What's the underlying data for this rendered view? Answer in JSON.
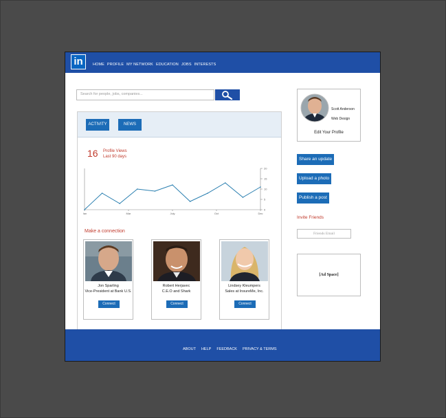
{
  "header": {
    "logo_text": "in",
    "nav": [
      "HOME",
      "PROFILE",
      "MY NETWORK",
      "EDUCATION",
      "JOBS",
      "INTERESTS"
    ]
  },
  "search": {
    "placeholder": "Search for people, jobs, companies..."
  },
  "activity": {
    "tabs": [
      "ACTIVITY",
      "NEWS"
    ],
    "profile_views_count": "16",
    "profile_views_label": "Profile Views",
    "profile_views_period": "Last 90 days"
  },
  "chart_data": {
    "type": "line",
    "x": [
      "Jan",
      "Mar",
      "July",
      "Oct",
      "Dec"
    ],
    "values": [
      0,
      8,
      3,
      10,
      9,
      12,
      4,
      8,
      13,
      6,
      11
    ],
    "y_ticks": [
      "0",
      "5",
      "10",
      "15",
      "20"
    ],
    "ylim": [
      0,
      20
    ],
    "grid": false
  },
  "connections": {
    "heading": "Make a connection",
    "people": [
      {
        "name": "Jon Sparling",
        "title": "Vice-President at Bank U.S.",
        "button": "Connect"
      },
      {
        "name": "Robert Herjavec",
        "title": "C.E.O and Shark",
        "button": "Connect"
      },
      {
        "name": "Lindsey Kleumpers",
        "title": "Sales at InsureMe, Inc.",
        "button": "Connect"
      }
    ]
  },
  "profile": {
    "name": "Scott Anderson",
    "role": "Web Design",
    "edit": "Edit Your Profile"
  },
  "actions": [
    "Share an update",
    "Upload a photo",
    "Publish a post"
  ],
  "invite": {
    "heading": "Invite Friends",
    "placeholder": "Friends Email"
  },
  "ad": "[Ad Space]",
  "footer": [
    "ABOUT",
    "HELP",
    "FEEDBACK",
    "PRIVACY & TERMS"
  ],
  "colors": {
    "brand_blue": "#1f4fa6",
    "button_blue": "#1c6cb7",
    "accent_red": "#c0392b",
    "chart_line": "#2a7fb0"
  }
}
